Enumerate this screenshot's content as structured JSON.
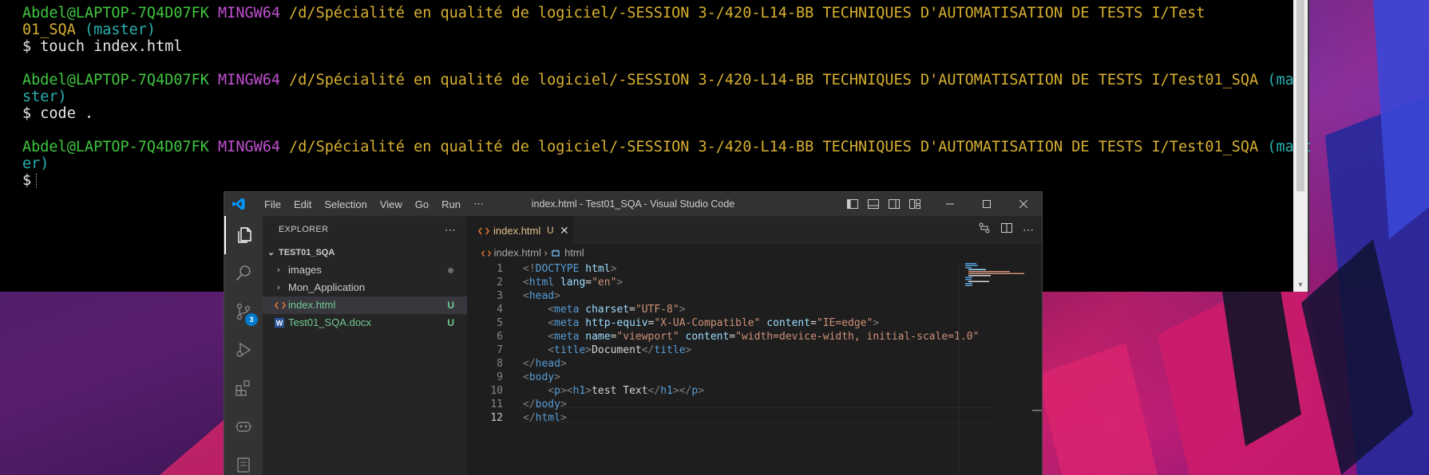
{
  "terminal": {
    "lines": [
      {
        "user": "Abdel@LAPTOP-7Q4D07FK",
        "sys": "MINGW64",
        "path": "/d/Spécialité en qualité de logiciel/-SESSION 3-/420-L14-BB TECHNIQUES D'AUTOMATISATION DE TESTS I/Test",
        "path2": "01_SQA",
        "branch": "(master)"
      },
      {
        "cmd": "$ touch index.html"
      },
      {
        "user": "Abdel@LAPTOP-7Q4D07FK",
        "sys": "MINGW64",
        "path": "/d/Spécialité en qualité de logiciel/-SESSION 3-/420-L14-BB TECHNIQUES D'AUTOMATISATION DE TESTS I/Test01_SQA",
        "branch_a": "(ma",
        "branch_b": "ster)"
      },
      {
        "cmd": "$ code ."
      },
      {
        "user": "Abdel@LAPTOP-7Q4D07FK",
        "sys": "MINGW64",
        "path": "/d/Spécialité en qualité de logiciel/-SESSION 3-/420-L14-BB TECHNIQUES D'AUTOMATISATION DE TESTS I/Test01_SQA",
        "branch_a": "(mast",
        "branch_b": "er)"
      },
      {
        "cmd": "$"
      }
    ]
  },
  "vscode": {
    "menu": [
      "File",
      "Edit",
      "Selection",
      "View",
      "Go",
      "Run",
      "⋯"
    ],
    "window_title": "index.html - Test01_SQA - Visual Studio Code",
    "scm_badge": "3",
    "explorer": {
      "header": "EXPLORER",
      "more": "⋯",
      "folder": "TEST01_SQA",
      "items": [
        {
          "label": "images",
          "type": "folder"
        },
        {
          "label": "Mon_Application",
          "type": "folder"
        },
        {
          "label": "index.html",
          "type": "html",
          "status": "U"
        },
        {
          "label": "Test01_SQA.docx",
          "type": "docx",
          "status": "U"
        }
      ]
    },
    "tab": {
      "name": "index.html",
      "status": "U",
      "close": "✕"
    },
    "breadcrumb": {
      "file": "index.html",
      "separator": "›",
      "symbol": "html"
    },
    "line_numbers": [
      "1",
      "2",
      "3",
      "4",
      "5",
      "6",
      "7",
      "8",
      "9",
      "10",
      "11",
      "12"
    ],
    "colors": {
      "accent": "#007acc",
      "untracked": "#73c991",
      "modified_tab": "#e2c08d"
    }
  }
}
